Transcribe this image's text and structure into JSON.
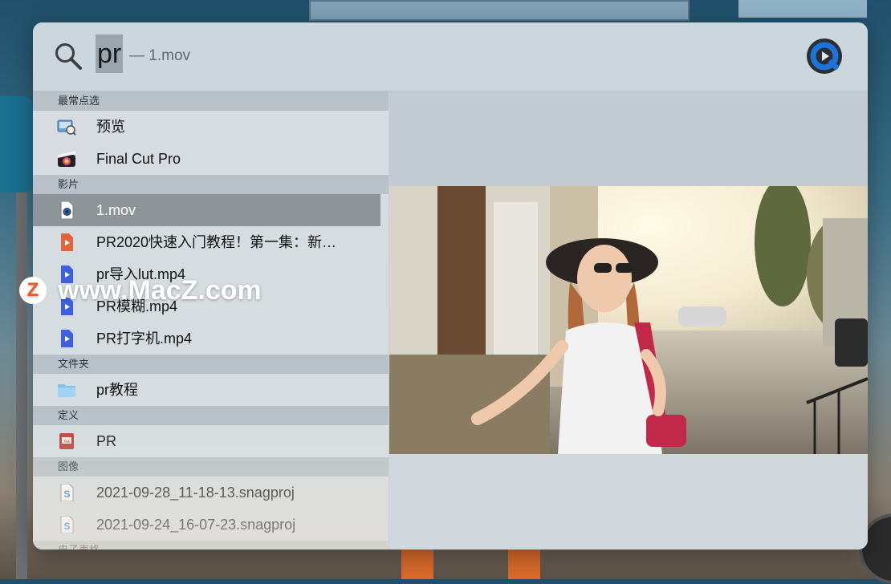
{
  "search": {
    "query": "pr",
    "subtitle": "— 1.mov"
  },
  "sections": [
    {
      "title": "最常点选",
      "items": [
        {
          "label": "预览",
          "icon": "preview-app-icon"
        },
        {
          "label": "Final Cut Pro",
          "icon": "final-cut-pro-icon"
        }
      ]
    },
    {
      "title": "影片",
      "items": [
        {
          "label": "1.mov",
          "icon": "quicktime-file-icon",
          "selected": true
        },
        {
          "label": "PR2020快速入门教程！第一集：新…",
          "icon": "video-file-icon"
        },
        {
          "label": "pr导入lut.mp4",
          "icon": "video-file-icon"
        },
        {
          "label": "PR模糊.mp4",
          "icon": "video-file-icon"
        },
        {
          "label": "PR打字机.mp4",
          "icon": "video-file-icon"
        }
      ]
    },
    {
      "title": "文件夹",
      "items": [
        {
          "label": "pr教程",
          "icon": "folder-icon"
        }
      ]
    },
    {
      "title": "定义",
      "items": [
        {
          "label": "PR",
          "icon": "dictionary-icon"
        }
      ]
    },
    {
      "title": "图像",
      "items": [
        {
          "label": "2021-09-28_11-18-13.snagproj",
          "icon": "snagit-file-icon"
        },
        {
          "label": "2021-09-24_16-07-23.snagproj",
          "icon": "snagit-file-icon"
        }
      ]
    },
    {
      "title": "电子表格",
      "items": []
    }
  ],
  "watermark": {
    "badge": "Z",
    "text": "www.MacZ.com"
  },
  "colors": {
    "selected_row": "#8d9599",
    "section_header": "#b7c1c7",
    "quicktime_blue": "#1e73d9"
  }
}
